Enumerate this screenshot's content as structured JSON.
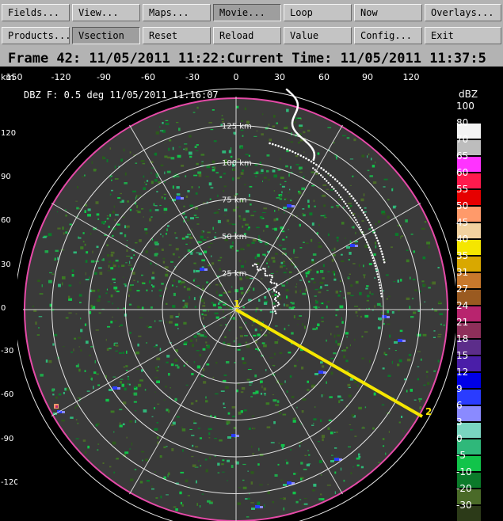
{
  "toolbar": {
    "row1": [
      "Fields...",
      "View...",
      "Maps...",
      "Movie...",
      "Loop",
      "Now",
      "Overlays..."
    ],
    "row2": [
      "Products...",
      "Vsection",
      "Reset",
      "Reload",
      "Value",
      "Config...",
      "Exit"
    ]
  },
  "frame_status": "Frame 42: 11/05/2011 11:22:Current Time: 11/05/2011 11:37:5",
  "axes": {
    "top_unit": "km",
    "top_ticks": [
      "150",
      "-120",
      "-90",
      "-60",
      "-30",
      "0",
      "30",
      "60",
      "90",
      "120"
    ],
    "left_ticks": [
      "120",
      "90",
      "60",
      "30",
      "0",
      "-30",
      "-60",
      "-90",
      "-120"
    ]
  },
  "plot": {
    "title": "DBZ F: 0.5 deg 11/05/2011 11:16:07",
    "range_rings": [
      "25 km",
      "50 km",
      "75 km",
      "100 km",
      "125 km"
    ],
    "vsection_points": [
      "1",
      "2"
    ]
  },
  "colorscale": {
    "title": "dBZ",
    "entries": [
      {
        "label": "100",
        "color": "#000000"
      },
      {
        "label": "80",
        "color": "#f4f4f4"
      },
      {
        "label": "70",
        "color": "#bdbdbd"
      },
      {
        "label": "65",
        "color": "#ff33ff"
      },
      {
        "label": "60",
        "color": "#ff1a4d"
      },
      {
        "label": "55",
        "color": "#e60000"
      },
      {
        "label": "50",
        "color": "#ff9a6a"
      },
      {
        "label": "45",
        "color": "#f2d2a0"
      },
      {
        "label": "40",
        "color": "#f5e600"
      },
      {
        "label": "35",
        "color": "#d9a800"
      },
      {
        "label": "31",
        "color": "#c8782c"
      },
      {
        "label": "27",
        "color": "#9a5a20"
      },
      {
        "label": "24",
        "color": "#b8246e"
      },
      {
        "label": "21",
        "color": "#8e2f5a"
      },
      {
        "label": "18",
        "color": "#5c2d8a"
      },
      {
        "label": "15",
        "color": "#4a1ea8"
      },
      {
        "label": "12",
        "color": "#0000e6"
      },
      {
        "label": "9",
        "color": "#2a3cff"
      },
      {
        "label": "6",
        "color": "#8a8aff"
      },
      {
        "label": "3",
        "color": "#7ad5c0"
      },
      {
        "label": "0",
        "color": "#2fb87a"
      },
      {
        "label": "-5",
        "color": "#11c44a"
      },
      {
        "label": "-10",
        "color": "#0b7a2a"
      },
      {
        "label": "-20",
        "color": "#4a6a28"
      },
      {
        "label": "-30",
        "color": "#2c3a18"
      }
    ]
  }
}
